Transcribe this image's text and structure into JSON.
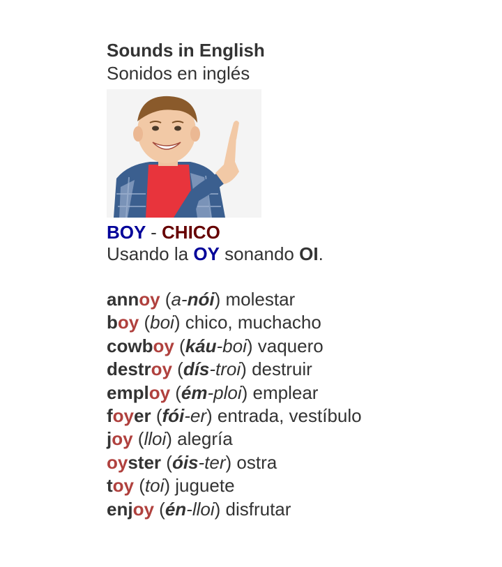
{
  "title": "Sounds in English",
  "subtitle": "Sonidos en inglés",
  "image": {
    "alt": "Boy pointing upward",
    "icon": "boy-pointing-photo"
  },
  "heading": {
    "english": "BOY",
    "separator": "-",
    "spanish": "CHICO"
  },
  "usage": {
    "pre": "Usando la ",
    "key": "OY",
    "mid": " sonando ",
    "key2": "OI",
    "post": "."
  },
  "colors": {
    "highlight": "#b0413e",
    "blue": "#000099",
    "dark_red": "#660000",
    "text": "#333333"
  },
  "words": [
    {
      "w1": "ann",
      "hl": "oy",
      "w2": "",
      "p1": "a-",
      "pb": "nói",
      "p2": "",
      "meaning": "molestar"
    },
    {
      "w1": "b",
      "hl": "oy",
      "w2": "",
      "p1": "",
      "pb": "",
      "p2": "boi",
      "meaning": "chico, muchacho"
    },
    {
      "w1": "cowb",
      "hl": "oy",
      "w2": "",
      "p1": "",
      "pb": "káu",
      "p2": "-boi",
      "meaning": "vaquero"
    },
    {
      "w1": "destr",
      "hl": "oy",
      "w2": "",
      "p1": "",
      "pb": "dís",
      "p2": "-troi",
      "meaning": "destruir"
    },
    {
      "w1": "empl",
      "hl": "oy",
      "w2": "",
      "p1": "",
      "pb": "ém",
      "p2": "-ploi",
      "meaning": "emplear"
    },
    {
      "w1": "f",
      "hl": "oy",
      "w2": "er",
      "p1": "",
      "pb": "fói",
      "p2": "-er",
      "meaning": "entrada, vestíbulo"
    },
    {
      "w1": "j",
      "hl": "oy",
      "w2": "",
      "p1": "",
      "pb": "",
      "p2": "lloi",
      "meaning": "alegría"
    },
    {
      "w1": "",
      "hl": "oy",
      "w2": "ster",
      "p1": "",
      "pb": "óis",
      "p2": "-ter",
      "meaning": "ostra"
    },
    {
      "w1": "t",
      "hl": "oy",
      "w2": "",
      "p1": "",
      "pb": "",
      "p2": "toi",
      "meaning": "juguete"
    },
    {
      "w1": "enj",
      "hl": "oy",
      "w2": "",
      "p1": "",
      "pb": "én",
      "p2": "-lloi",
      "meaning": "disfrutar"
    }
  ]
}
